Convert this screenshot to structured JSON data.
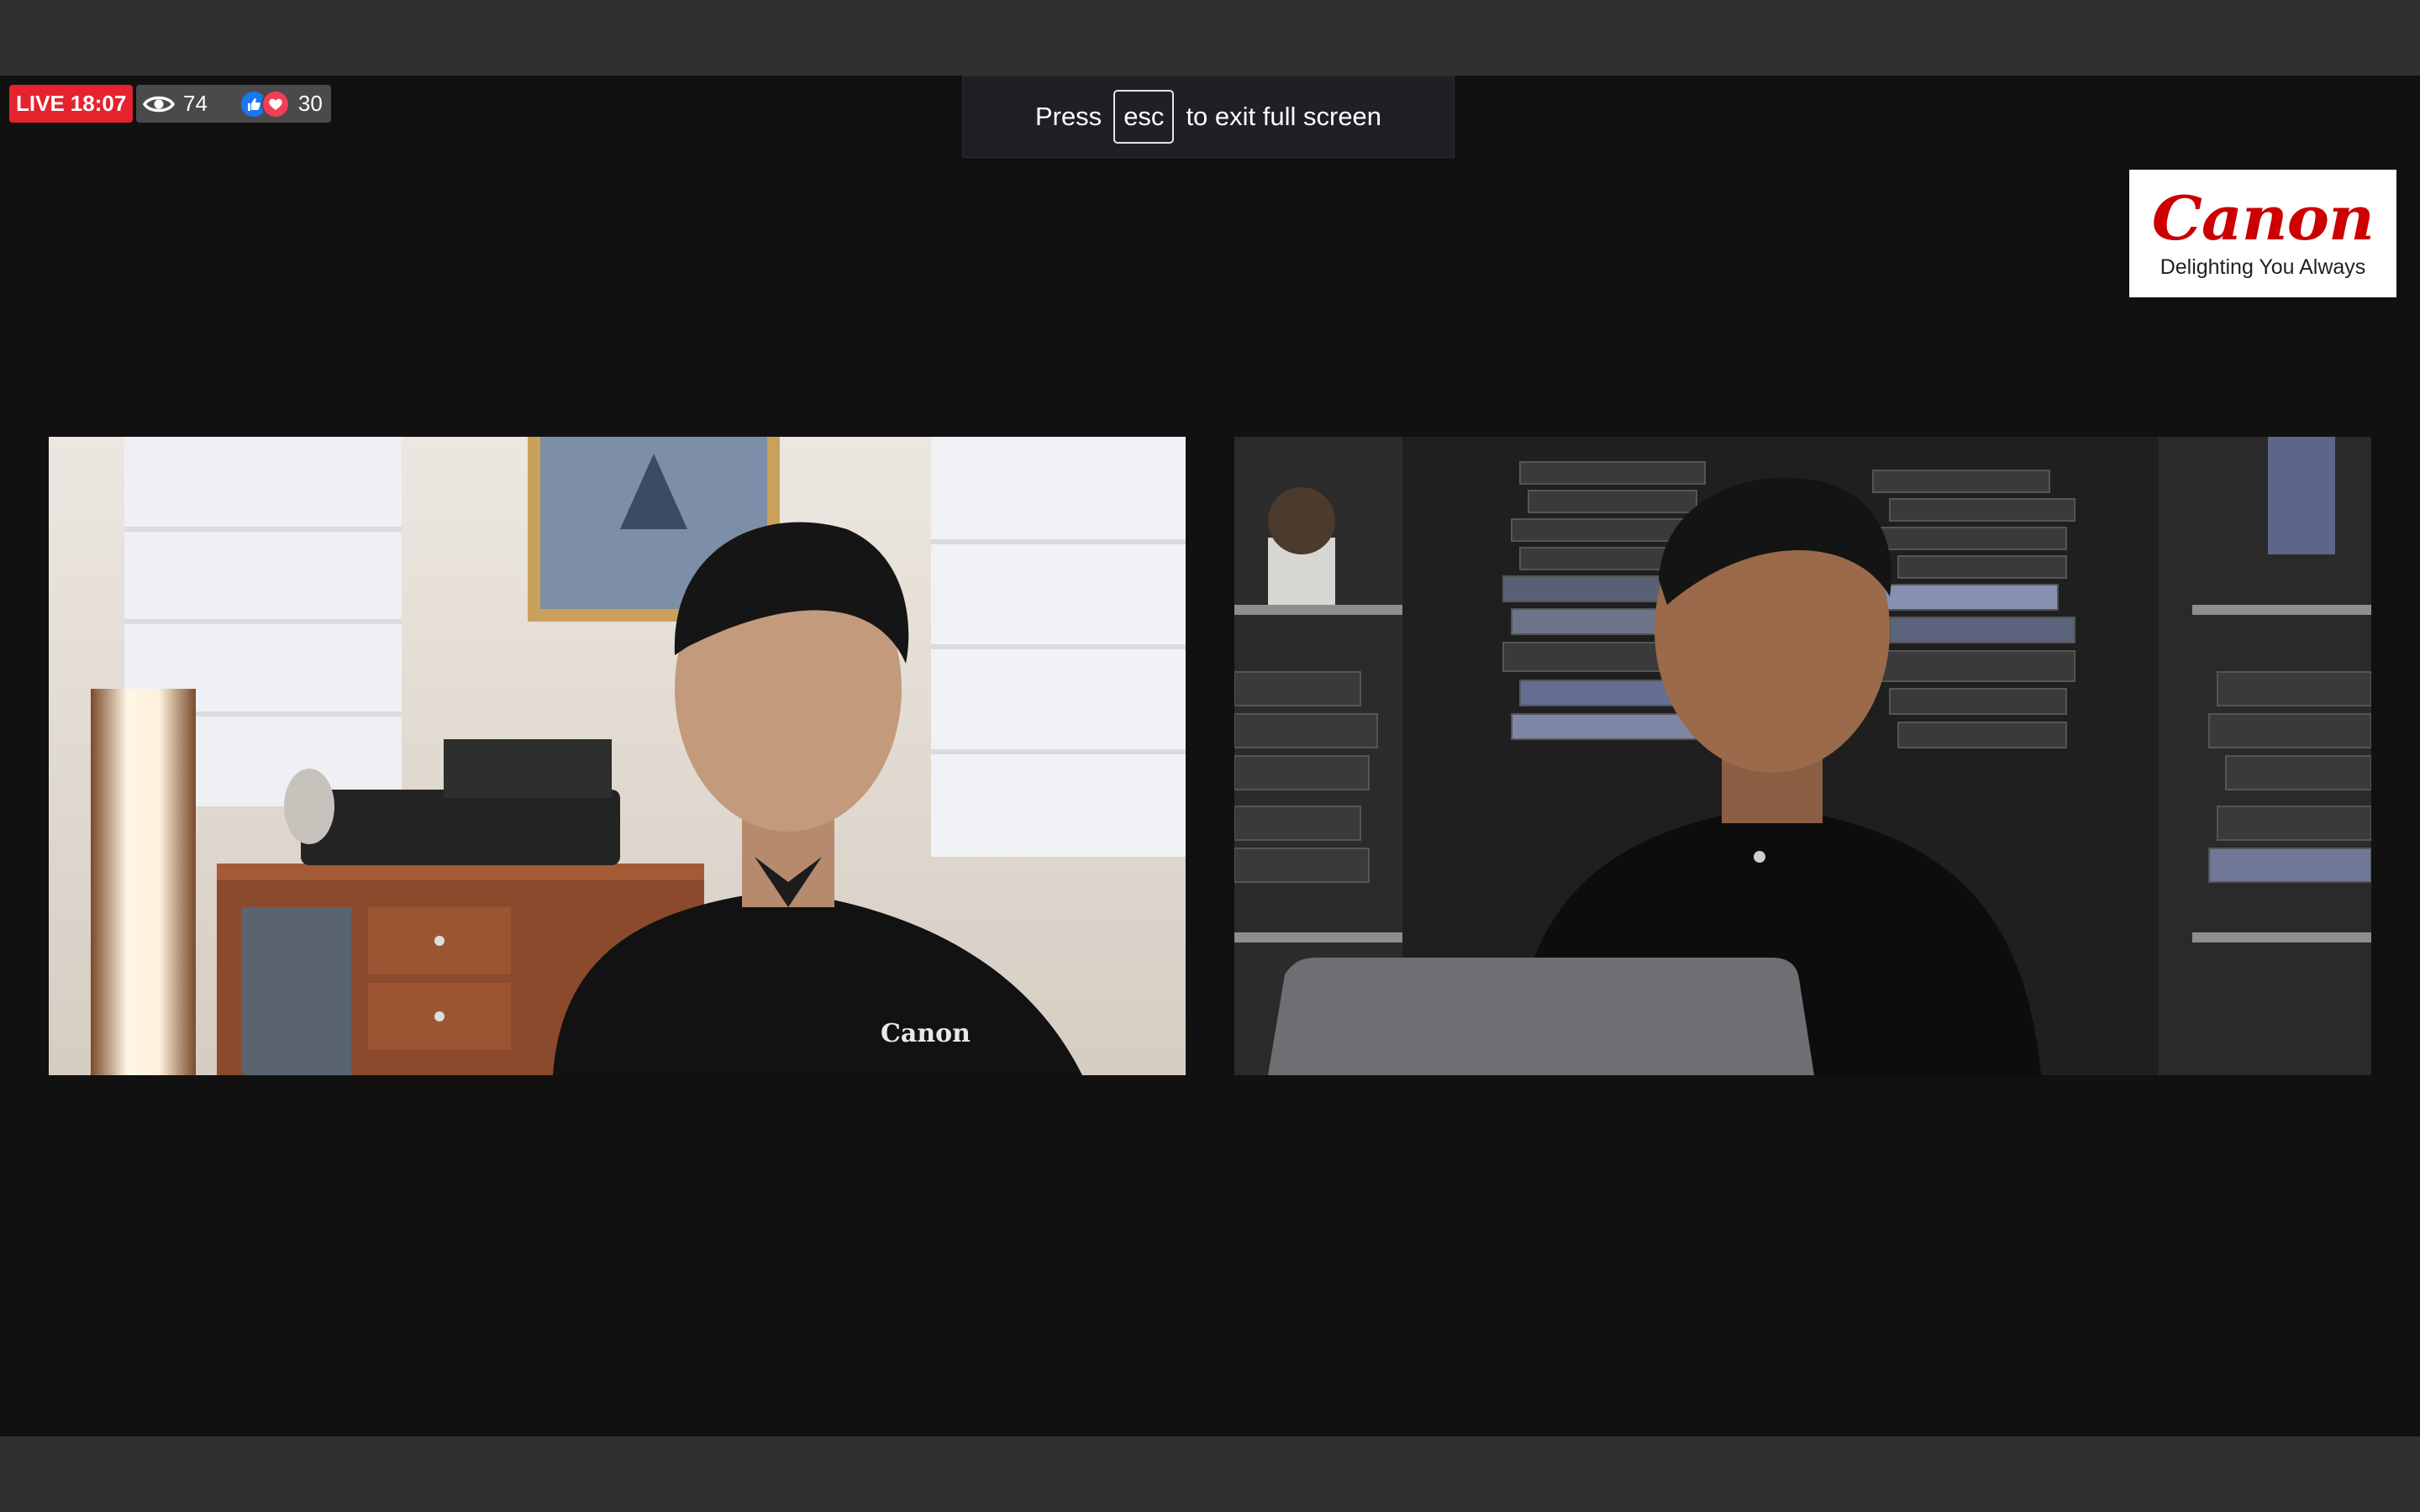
{
  "live": {
    "label": "LIVE",
    "timer": "18:07",
    "viewers": "74",
    "reactions": "30",
    "colors": {
      "live_red": "#e4232e",
      "like_blue": "#1877f2",
      "love_red": "#f33e58"
    },
    "icons": [
      "eye-icon",
      "like-icon",
      "love-icon"
    ]
  },
  "fullscreen_hint": {
    "prefix": "Press",
    "key": "esc",
    "suffix": "to exit full screen"
  },
  "logo": {
    "wordmark": "Canon",
    "tagline": "Delighting You Always",
    "color": "#cc0000"
  },
  "video": {
    "left_shirt_logo": "Canon"
  }
}
